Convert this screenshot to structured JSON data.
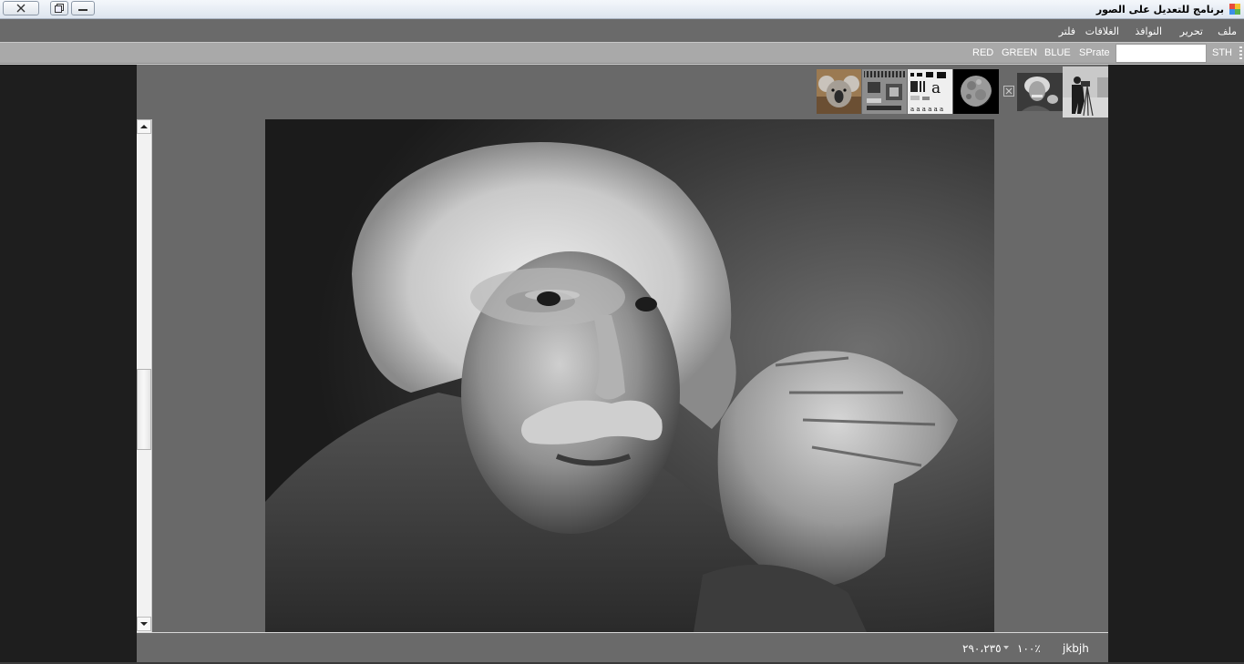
{
  "window": {
    "title": "برنامج للتعديل على الصور",
    "icon": "app-palette-icon"
  },
  "menu": {
    "items": [
      "ملف",
      "تحرير",
      "النوافذ",
      "الغلافات",
      "فلتر"
    ]
  },
  "toolbar": {
    "sth_label": "STH",
    "sprate_label": "SPrate",
    "blue_label": "BLUE",
    "green_label": "GREEN",
    "red_label": "RED",
    "input_value": ""
  },
  "thumbnails": [
    {
      "name": "koala",
      "kind": "photo"
    },
    {
      "name": "circuit-board",
      "kind": "photo"
    },
    {
      "name": "text-pattern",
      "kind": "photo"
    },
    {
      "name": "moon",
      "kind": "photo"
    },
    {
      "name": "einstein",
      "kind": "photo"
    },
    {
      "name": "cameraman",
      "kind": "photo",
      "active": true
    }
  ],
  "status": {
    "label": "jkbjh",
    "zoom": "١٠٠٪",
    "coords": "٢٩٠،٢٣٥"
  },
  "colors": {
    "menubar": "#6a6a6a",
    "toolbar": "#a9a9a9",
    "workspace": "#696969",
    "background": "#1e1e1e"
  }
}
